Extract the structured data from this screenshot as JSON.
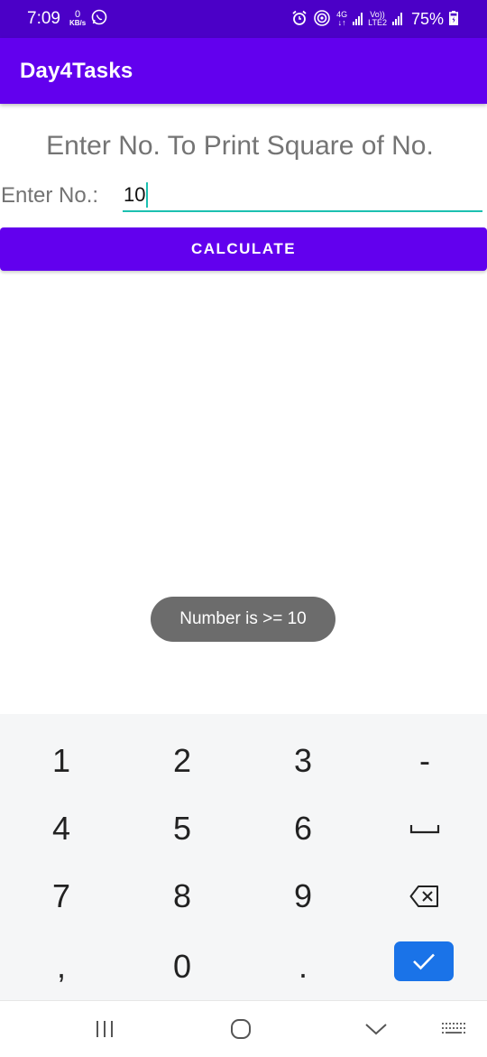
{
  "status_bar": {
    "time": "7:09",
    "net_speed_value": "0",
    "net_speed_unit": "KB/s",
    "network_type": "4G",
    "volte": "Vo))",
    "lte_label": "LTE2",
    "battery": "75%"
  },
  "app_bar": {
    "title": "Day4Tasks"
  },
  "main": {
    "heading": "Enter No. To Print Square of No.",
    "input_label": "Enter No.:",
    "input_value": "10",
    "calculate_label": "CALCULATE"
  },
  "toast": {
    "message": "Number is >= 10"
  },
  "keyboard": {
    "rows": [
      [
        "1",
        "2",
        "3",
        "-"
      ],
      [
        "4",
        "5",
        "6",
        "space"
      ],
      [
        "7",
        "8",
        "9",
        "backspace"
      ],
      [
        ",",
        "0",
        ".",
        "done"
      ]
    ],
    "done_color": "#1a73e8"
  },
  "colors": {
    "status_bar": "#4b00c7",
    "primary": "#6200ee",
    "accent": "#1cc0b0",
    "toast": "#6c6c6c"
  }
}
